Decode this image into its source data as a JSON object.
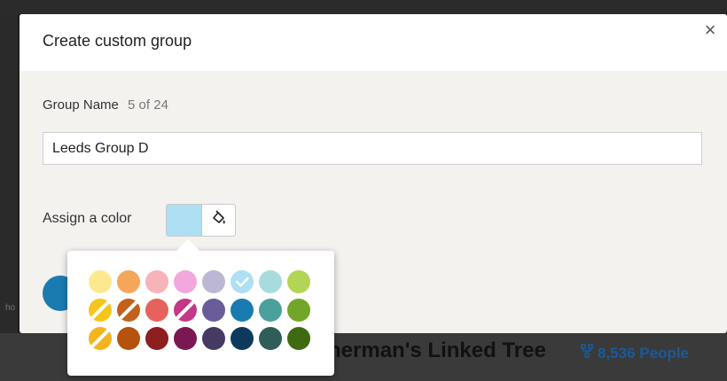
{
  "background": {
    "title": "herman's Linked Tree",
    "count": "8,536 People",
    "side_text": "ho"
  },
  "modal": {
    "title": "Create custom group",
    "close_label": "×",
    "group_name_label": "Group Name",
    "group_name_count": "5 of 24",
    "group_name_value": "Leeds Group D",
    "assign_label": "Assign a color",
    "selected_color": "#aedff2"
  },
  "palette": {
    "rows": [
      [
        {
          "color": "#fce98f",
          "style": "solid"
        },
        {
          "color": "#f4a65b",
          "style": "solid"
        },
        {
          "color": "#f6b3b8",
          "style": "solid"
        },
        {
          "color": "#f2a8dc",
          "style": "solid"
        },
        {
          "color": "#bdb7d6",
          "style": "solid"
        },
        {
          "color": "#aedff2",
          "style": "selected"
        },
        {
          "color": "#a8dcdc",
          "style": "solid"
        },
        {
          "color": "#b4d455",
          "style": "solid"
        }
      ],
      [
        {
          "color": "#f5c518",
          "style": "striped"
        },
        {
          "color": "#c2611b",
          "style": "striped"
        },
        {
          "color": "#e7625c",
          "style": "solid"
        },
        {
          "color": "#c23a86",
          "style": "striped"
        },
        {
          "color": "#6a5b9a",
          "style": "solid"
        },
        {
          "color": "#1a7bb0",
          "style": "solid"
        },
        {
          "color": "#4aa19c",
          "style": "solid"
        },
        {
          "color": "#72a629",
          "style": "solid"
        }
      ],
      [
        {
          "color": "#f3b51f",
          "style": "striped"
        },
        {
          "color": "#b5520c",
          "style": "solid"
        },
        {
          "color": "#8e1f1f",
          "style": "solid"
        },
        {
          "color": "#7a1852",
          "style": "solid"
        },
        {
          "color": "#463a63",
          "style": "solid"
        },
        {
          "color": "#0d3a5c",
          "style": "solid"
        },
        {
          "color": "#2e5e57",
          "style": "solid"
        },
        {
          "color": "#3f6a12",
          "style": "solid"
        }
      ]
    ]
  }
}
